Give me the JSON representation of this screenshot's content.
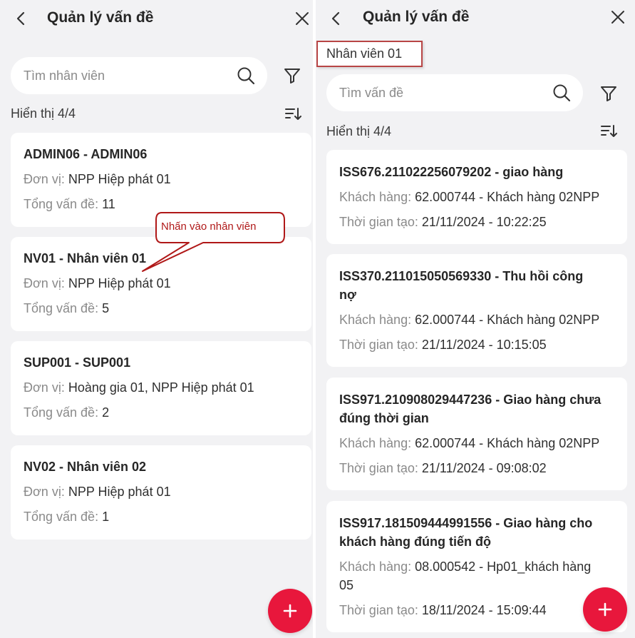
{
  "colors": {
    "accent": "#e8173c",
    "background": "#f2f2f4",
    "card": "#ffffff",
    "annotation": "#b01818"
  },
  "left": {
    "title": "Quản lý vấn đề",
    "search_placeholder": "Tìm nhân viên",
    "count_text": "Hiển thị 4/4",
    "items": [
      {
        "title": "ADMIN06 - ADMIN06",
        "unit_label": "Đơn vị:",
        "unit_value": " NPP Hiệp phát 01",
        "total_label": "Tổng vấn đề:",
        "total_value": " 11"
      },
      {
        "title": "NV01 - Nhân viên 01",
        "unit_label": "Đơn vị:",
        "unit_value": " NPP Hiệp phát 01",
        "total_label": "Tổng vấn đề:",
        "total_value": " 5"
      },
      {
        "title": "SUP001 - SUP001",
        "unit_label": "Đơn vị:",
        "unit_value": " Hoàng gia 01, NPP Hiệp phát 01",
        "total_label": "Tổng vấn đề:",
        "total_value": " 2"
      },
      {
        "title": "NV02 - Nhân viên 02",
        "unit_label": "Đơn vị:",
        "unit_value": " NPP Hiệp phát 01",
        "total_label": "Tổng vấn đề:",
        "total_value": " 1"
      }
    ],
    "fab_label": "+"
  },
  "right": {
    "title": "Quản lý vấn đề",
    "employee_name": "Nhân viên 01",
    "search_placeholder": "Tìm vấn đề",
    "count_text": "Hiển thị 4/4",
    "issues": [
      {
        "title_line1": "ISS676.211022256079202 - giao hàng",
        "title_line2": "",
        "customer_label": "Khách hàng:",
        "customer_line1": " 62.000744 - Khách hàng 02NPP",
        "customer_line2": "",
        "time_label": "Thời gian tạo:",
        "time_value": " 21/11/2024 - 10:22:25"
      },
      {
        "title_line1": "ISS370.211015050569330 - Thu  hồi công",
        "title_line2": "nợ",
        "customer_label": "Khách hàng:",
        "customer_line1": " 62.000744 - Khách hàng 02NPP",
        "customer_line2": "",
        "time_label": "Thời gian tạo:",
        "time_value": " 21/11/2024 - 10:15:05"
      },
      {
        "title_line1": "ISS971.210908029447236 - Giao hàng chưa",
        "title_line2": "đúng thời gian",
        "customer_label": "Khách hàng:",
        "customer_line1": " 62.000744 - Khách hàng 02NPP",
        "customer_line2": "",
        "time_label": "Thời gian tạo:",
        "time_value": " 21/11/2024 - 09:08:02"
      },
      {
        "title_line1": "ISS917.181509444991556 - Giao hàng cho",
        "title_line2": "khách hàng đúng tiến độ",
        "customer_label": "Khách hàng:",
        "customer_line1": " 08.000542 - Hp01_khách hàng",
        "customer_line2": "05",
        "time_label": "Thời gian tạo:",
        "time_value": " 18/11/2024 - 15:09:44"
      }
    ],
    "fab_label": "+"
  },
  "annotation": {
    "text": "Nhấn vào nhân viên"
  }
}
